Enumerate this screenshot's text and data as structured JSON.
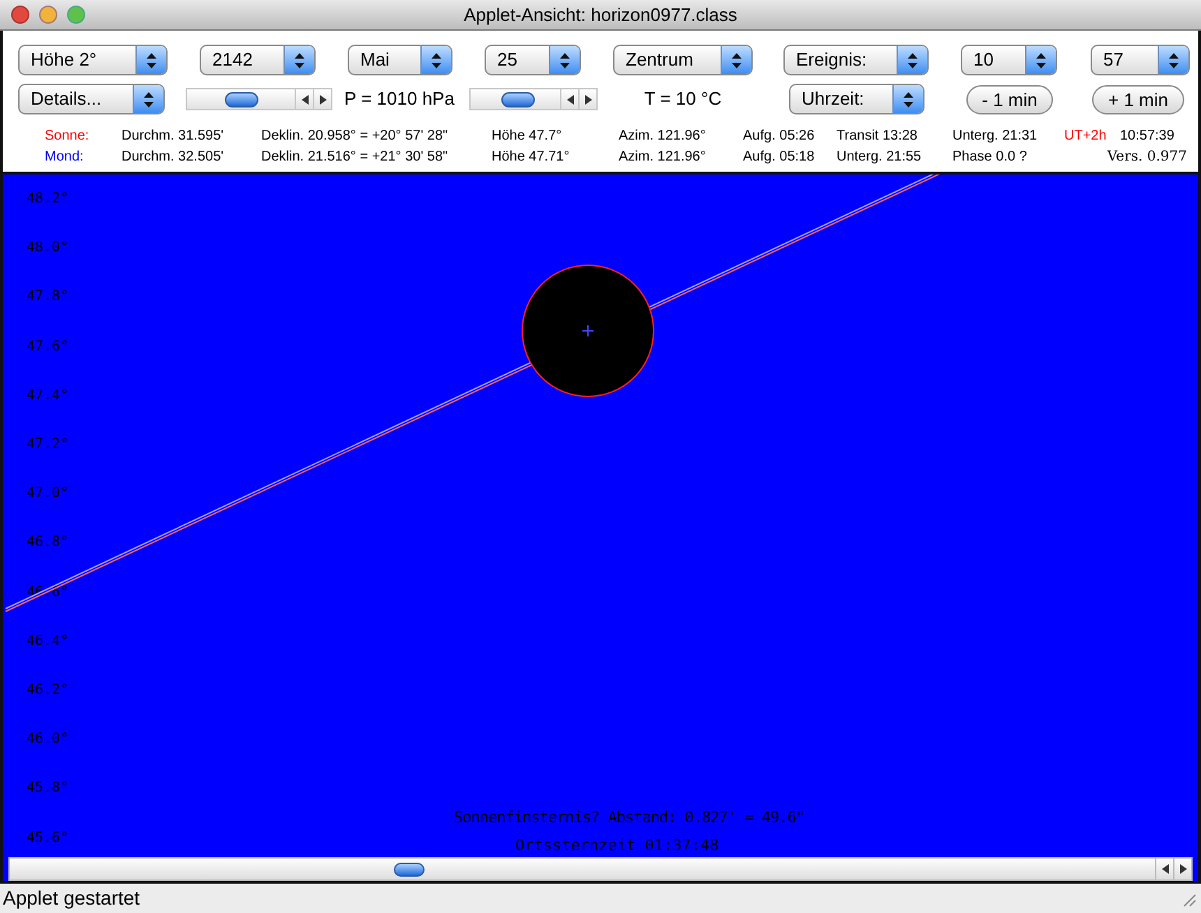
{
  "window": {
    "title": "Applet-Ansicht: horizon0977.class"
  },
  "controls": {
    "row_1": [
      {
        "kind": "dropdown",
        "value": "Höhe 2°"
      },
      {
        "kind": "dropdown",
        "value": "2142"
      },
      {
        "kind": "dropdown",
        "value": "Mai"
      },
      {
        "kind": "dropdown",
        "value": "25"
      },
      {
        "kind": "dropdown",
        "value": "Zentrum"
      },
      {
        "kind": "dropdown",
        "value": "Ereignis:"
      },
      {
        "kind": "dropdown",
        "value": "10"
      },
      {
        "kind": "dropdown",
        "value": "57"
      }
    ],
    "row_2": [
      {
        "kind": "dropdown",
        "value": "Details..."
      },
      {
        "kind": "slider",
        "level": 0.4
      },
      {
        "kind": "text",
        "value": "P = 1010 hPa"
      },
      {
        "kind": "slider",
        "level": 0.4
      },
      {
        "kind": "text",
        "value": "T = 10 °C"
      },
      {
        "kind": "dropdown",
        "value": "Uhrzeit:"
      },
      {
        "kind": "button",
        "value": "- 1 min"
      },
      {
        "kind": "button",
        "value": "+ 1 min"
      }
    ]
  },
  "info": {
    "rows": [
      {
        "label": "Sonne:",
        "color": "#ff0000",
        "cells": [
          "Durchm. 31.595'",
          "Deklin. 20.958° = +20° 57' 28\"",
          "Höhe 47.7°",
          "Azim. 121.96°",
          "Aufg. 05:26",
          "Transit 13:28",
          "Unterg. 21:31"
        ]
      },
      {
        "label": "Mond:",
        "color": "#0000ff",
        "cells": [
          "Durchm. 32.505'",
          "Deklin. 21.516° = +21° 30' 58\"",
          "Höhe 47.71°",
          "Azim. 121.96°",
          "Aufg. 05:18",
          "Unterg. 21:55",
          "Phase 0.0 ?"
        ]
      }
    ],
    "timezone": "UT+2h",
    "time": "10:57:39",
    "version": "Vers. 0.977"
  },
  "canvas": {
    "y_labels": [
      "48.2°",
      "48.0°",
      "47.8°",
      "47.6°",
      "47.4°",
      "47.2°",
      "47.0°",
      "46.8°",
      "46.6°",
      "46.4°",
      "46.2°",
      "46.0°",
      "45.8°",
      "45.6°"
    ],
    "eclipse_text": "Sonnenfinsternis? Abstand: 0.827' = 49.6\"",
    "sidereal_time": "Ortssternzeit 01:37:48",
    "scrollbar": {
      "level": 0.35
    }
  },
  "status_bar": {
    "text": "Applet gestartet"
  }
}
